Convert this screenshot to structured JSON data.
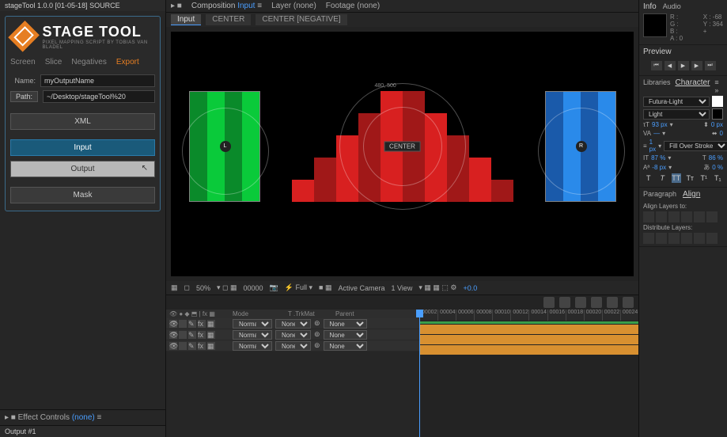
{
  "panel_title": "stageTool 1.0.0 [01-05-18] SOURCE",
  "logo": {
    "main": "STAGE TOOL",
    "sub": "PIXEL MAPPING SCRIPT BY TOBIAS VAN BLADEL"
  },
  "tabs": {
    "screen": "Screen",
    "slice": "Slice",
    "negatives": "Negatives",
    "export": "Export"
  },
  "form": {
    "name_label": "Name:",
    "name_value": "myOutputName",
    "path_label": "Path:",
    "path_value": "~/Desktop/stageTool%20"
  },
  "buttons": {
    "xml": "XML",
    "input": "Input",
    "output": "Output",
    "mask": "Mask"
  },
  "effect_controls": {
    "label": "Effect Controls",
    "link": "(none)"
  },
  "bottom_title": "Output #1",
  "comp_header": {
    "composition": "Composition",
    "input": "Input",
    "layer": "Layer (none)",
    "footage": "Footage (none)"
  },
  "comp_tabs": {
    "input": "Input",
    "center": "CENTER",
    "center_neg": "CENTER [NEGATIVE]"
  },
  "viewport": {
    "coord1": "480, 500",
    "center_label": "CENTER",
    "l_badge": "L",
    "r_badge": "R"
  },
  "footer": {
    "zoom": "50%",
    "time": "00000",
    "quality": "Full",
    "camera": "Active Camera",
    "view": "1 View",
    "exposure": "+0.0"
  },
  "timeline": {
    "cols": {
      "mode": "Mode",
      "trkmat": "T .TrkMat",
      "parent": "Parent"
    },
    "mode_val": "Normal",
    "trk_val": "None",
    "parent_val": "None",
    "ticks": [
      "00002",
      "00004",
      "00006",
      "00008",
      "00010",
      "00012",
      "00014",
      "00016",
      "00018",
      "00020",
      "00022",
      "00024"
    ]
  },
  "info": {
    "title": "Info",
    "audio": "Audio",
    "r": "R :",
    "g": "G :",
    "b": "B :",
    "a": "A : 0",
    "x": "X : -68",
    "y": "Y : 364",
    "plus": "+"
  },
  "preview": {
    "title": "Preview"
  },
  "character": {
    "libraries": "Libraries",
    "title": "Character",
    "font": "Futura-Light",
    "style": "Light",
    "size": "93 px",
    "leading": "0 px",
    "tracking": "0",
    "fill": "Fill Over Stroke",
    "stroke": "1 px",
    "scale1": "87 %",
    "scale2": "86 %",
    "baseline": "-8 px",
    "pct": "0 %"
  },
  "paragraph": {
    "title": "Paragraph",
    "align": "Align"
  },
  "align_panel": {
    "layers": "Align Layers to:",
    "distribute": "Distribute Layers:"
  }
}
